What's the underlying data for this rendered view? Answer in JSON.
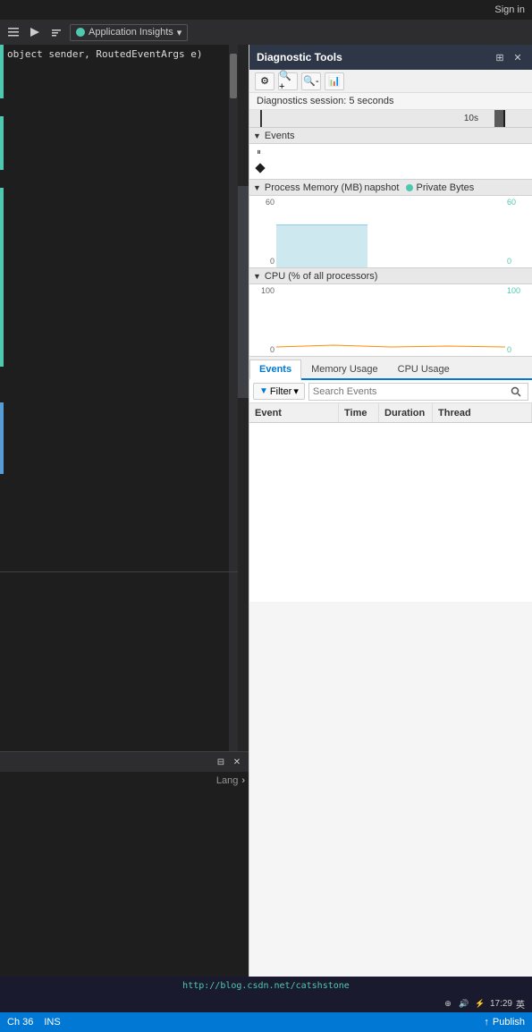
{
  "topbar": {
    "sign_in": "Sign in"
  },
  "menubar": {
    "app_insights_label": "Application Insights",
    "arrow_symbol": "▾"
  },
  "code_editor": {
    "line1": "object sender, RoutedEventArgs e)"
  },
  "bottom_panel": {
    "lang_label": "Lang"
  },
  "diagnostic_tools": {
    "title": "Diagnostic Tools",
    "pin_symbol": "⊞",
    "close_symbol": "✕",
    "session_text": "Diagnostics session: 5 seconds",
    "timeline_10s": "10s",
    "events_label": "Events",
    "memory_label": "Process Memory (MB)",
    "memory_snapshot": "napshot",
    "memory_legend": "Private Bytes",
    "cpu_label": "CPU (% of all processors)",
    "memory_max_left": "60",
    "memory_min_left": "0",
    "memory_max_right": "60",
    "memory_min_right": "0",
    "cpu_max_left": "100",
    "cpu_min_left": "0",
    "cpu_max_right": "100",
    "cpu_min_right": "0"
  },
  "tabs": {
    "events": "Events",
    "memory_usage": "Memory Usage",
    "cpu_usage": "CPU Usage"
  },
  "filter_bar": {
    "filter_label": "Filter",
    "filter_arrow": "▾",
    "search_placeholder": "Search Events"
  },
  "table": {
    "col_event": "Event",
    "col_time": "Time",
    "col_duration": "Duration",
    "col_thread": "Thread"
  },
  "status_bar": {
    "ch": "Ch 36",
    "ins": "INS",
    "publish_arrow": "↑",
    "publish_label": "Publish"
  },
  "watermark": {
    "url": "http://blog.csdn.net/catshstone"
  },
  "taskbar": {
    "time": "17:29"
  }
}
